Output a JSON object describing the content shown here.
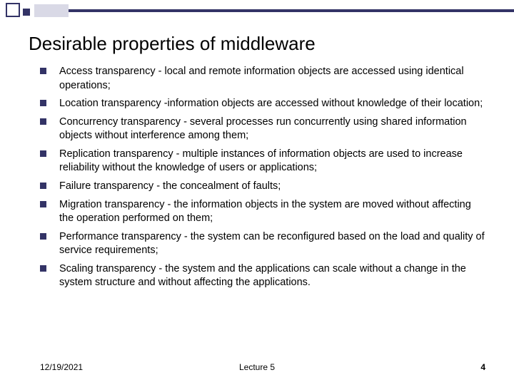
{
  "title": "Desirable properties of middleware",
  "items": [
    "Access transparency - local and remote information objects are accessed using identical operations;",
    "Location transparency -information objects are accessed without knowledge of their location;",
    "Concurrency transparency - several  processes run concurrently using shared information objects without interference among them;",
    "Replication transparency - multiple instances of information objects are used to increase reliability without the knowledge of users or applications;",
    "Failure transparency - the concealment of faults;",
    "Migration transparency - the information objects in the system are moved without affecting the operation performed on them;",
    "Performance transparency - the system can be reconfigured based on the load and quality of service requirements;",
    "Scaling transparency - the system and the applications can scale without a change in the system structure and without affecting the applications."
  ],
  "footer": {
    "date": "12/19/2021",
    "center": "Lecture 5",
    "page": "4"
  }
}
